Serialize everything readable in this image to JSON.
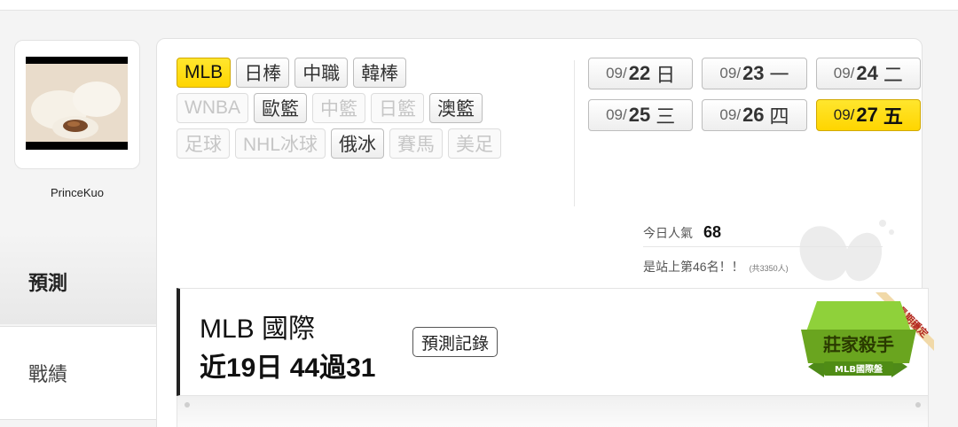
{
  "profile": {
    "username": "PrinceKuo"
  },
  "sidenav": {
    "items": [
      {
        "label": "預測"
      },
      {
        "label": "戰績"
      }
    ]
  },
  "sports": {
    "rows": [
      [
        {
          "label": "MLB",
          "state": "active"
        },
        {
          "label": "日棒",
          "state": "normal"
        },
        {
          "label": "中職",
          "state": "normal"
        },
        {
          "label": "韓棒",
          "state": "normal"
        }
      ],
      [
        {
          "label": "WNBA",
          "state": "disabled"
        },
        {
          "label": "歐籃",
          "state": "normal"
        },
        {
          "label": "中籃",
          "state": "disabled"
        },
        {
          "label": "日籃",
          "state": "disabled"
        },
        {
          "label": "澳籃",
          "state": "normal"
        }
      ],
      [
        {
          "label": "足球",
          "state": "disabled"
        },
        {
          "label": "NHL冰球",
          "state": "disabled"
        },
        {
          "label": "俄冰",
          "state": "normal"
        },
        {
          "label": "賽馬",
          "state": "disabled"
        },
        {
          "label": "美足",
          "state": "disabled"
        }
      ]
    ]
  },
  "dates": {
    "rows": [
      [
        {
          "month": "09/",
          "day": "22",
          "weekday": "日",
          "active": false
        },
        {
          "month": "09/",
          "day": "23",
          "weekday": "一",
          "active": false
        },
        {
          "month": "09/",
          "day": "24",
          "weekday": "二",
          "active": false
        }
      ],
      [
        {
          "month": "09/",
          "day": "25",
          "weekday": "三",
          "active": false
        },
        {
          "month": "09/",
          "day": "26",
          "weekday": "四",
          "active": false
        },
        {
          "month": "09/",
          "day": "27",
          "weekday": "五",
          "active": true
        }
      ]
    ]
  },
  "stats": {
    "popularity_label": "今日人氣",
    "popularity_value": "68",
    "rank_text": "是站上第46名！！",
    "rank_total": "(共3350人)"
  },
  "record": {
    "league": "MLB 國際",
    "stat": "近19日 44過31",
    "history_button": "預測記錄"
  },
  "badge": {
    "title": "莊家殺手",
    "subtitle": "MLB國際盤",
    "ribbon": "長期穩定"
  },
  "colors": {
    "active_yellow": "#ffd500",
    "badge_green": "#6aa51f"
  }
}
